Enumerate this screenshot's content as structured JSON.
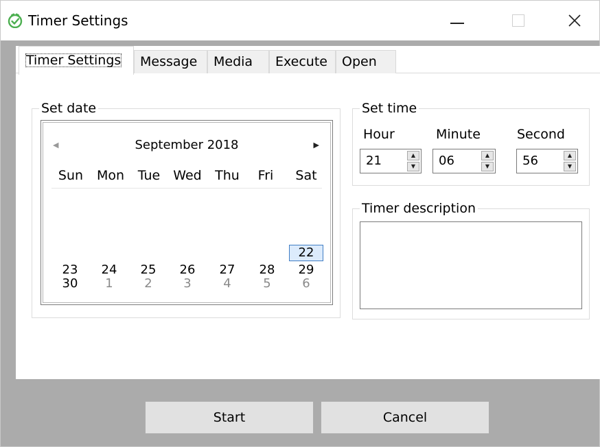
{
  "window": {
    "title": "Timer Settings",
    "accent_color": "#4caf50"
  },
  "tabs": [
    "Timer Settings",
    "Message",
    "Media",
    "Execute",
    "Open"
  ],
  "date_group": {
    "label": "Set date",
    "calendar": {
      "month_year": "September 2018",
      "days_of_week": [
        "Sun",
        "Mon",
        "Tue",
        "Wed",
        "Thu",
        "Fri",
        "Sat"
      ],
      "rows": [
        [
          "",
          "",
          "",
          "",
          "",
          "",
          "22"
        ],
        [
          "23",
          "24",
          "25",
          "26",
          "27",
          "28",
          "29"
        ],
        [
          "30",
          "1",
          "2",
          "3",
          "4",
          "5",
          "6"
        ]
      ],
      "selected_day": "22"
    }
  },
  "time_group": {
    "label": "Set time",
    "hour_label": "Hour",
    "minute_label": "Minute",
    "second_label": "Second",
    "hour": "21",
    "minute": "06",
    "second": "56"
  },
  "description_group": {
    "label": "Timer description",
    "value": ""
  },
  "buttons": {
    "start": "Start",
    "cancel": "Cancel"
  }
}
